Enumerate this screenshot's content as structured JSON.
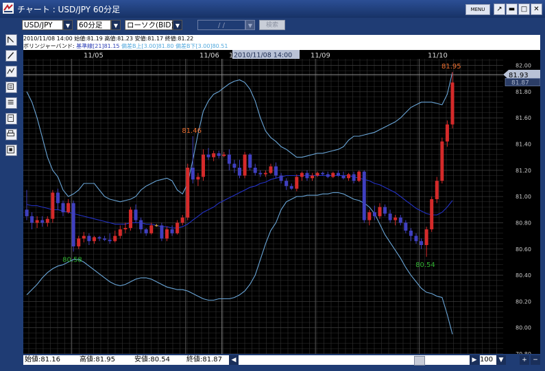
{
  "window": {
    "title": "チャート : USD/JPY 60分足",
    "menu_label": "MENU",
    "pin_glyph": "↗",
    "min_glyph": "▬",
    "max_glyph": "□",
    "close_glyph": "✕"
  },
  "toolbar": {
    "pair": "USD/JPY",
    "interval": "60分足",
    "price_type": "ローソク(BID)",
    "date_placeholder": "/ /",
    "search_label": "検索",
    "dropdown_glyph": "▼"
  },
  "info": {
    "line1": "2010/11/08 14:00  始値:81.19  高値:81.23  安値:81.17  終値:81.22",
    "bollinger_label": "ボリンジャーバンド:",
    "bollinger_base": "基準線[21]81.15",
    "bollinger_upper": "偏差B上[3.00]81.80",
    "bollinger_lower": "偏差B下[3.00]80.51"
  },
  "status": {
    "open": "始値:81.16",
    "high": "高値:81.95",
    "low": "安値:80.54",
    "close": "終値:81.87"
  },
  "zoom": {
    "value": "100",
    "plus": "+",
    "minus": "−"
  },
  "colors": {
    "bull": "#d42a2a",
    "bear": "#3f3fbf",
    "doji": "#e6b033",
    "band": "#6aa6d8",
    "base": "#2432c8",
    "grid": "#323232",
    "bg": "#000000",
    "high_label": "#f07030",
    "low_label": "#2fb02f"
  },
  "chart_data": {
    "type": "candlestick",
    "title": "USD/JPY 60分足",
    "x_labels": [
      "11/05",
      "11/06",
      "11/08",
      "11/09",
      "11/10"
    ],
    "ylim": [
      79.8,
      82.05
    ],
    "y_ticks": [
      79.8,
      80.0,
      80.2,
      80.4,
      80.6,
      80.8,
      81.0,
      81.2,
      81.4,
      81.6,
      81.8,
      82.0
    ],
    "crosshair": {
      "date_label": "2010/11/08 14:00",
      "price_label": "81.93"
    },
    "current_price": "81.87",
    "annotations": [
      {
        "text": "81.46",
        "kind": "high",
        "index": 32
      },
      {
        "text": "80.58",
        "kind": "low",
        "index": 9
      },
      {
        "text": "80.54",
        "kind": "low",
        "index": 77
      },
      {
        "text": "81.95",
        "kind": "high",
        "index": 82
      }
    ],
    "ohlc": [
      [
        80.9,
        81.05,
        80.82,
        80.85
      ],
      [
        80.85,
        80.88,
        80.75,
        80.8
      ],
      [
        80.8,
        80.85,
        80.76,
        80.82
      ],
      [
        80.82,
        80.85,
        80.77,
        80.8
      ],
      [
        80.8,
        80.85,
        80.77,
        80.83
      ],
      [
        80.83,
        81.05,
        80.8,
        81.03
      ],
      [
        81.03,
        81.06,
        80.9,
        80.95
      ],
      [
        80.95,
        80.97,
        80.85,
        80.88
      ],
      [
        80.88,
        80.98,
        80.87,
        80.95
      ],
      [
        80.95,
        80.97,
        80.58,
        80.62
      ],
      [
        80.62,
        80.7,
        80.6,
        80.68
      ],
      [
        80.68,
        80.73,
        80.65,
        80.7
      ],
      [
        80.7,
        80.72,
        80.63,
        80.66
      ],
      [
        80.66,
        80.7,
        80.64,
        80.69
      ],
      [
        80.69,
        80.7,
        80.66,
        80.68
      ],
      [
        80.68,
        80.7,
        80.66,
        80.67
      ],
      [
        80.67,
        80.72,
        80.64,
        80.66
      ],
      [
        80.66,
        80.74,
        80.65,
        80.7
      ],
      [
        80.7,
        80.78,
        80.68,
        80.75
      ],
      [
        80.75,
        80.8,
        80.72,
        80.76
      ],
      [
        80.76,
        80.92,
        80.74,
        80.9
      ],
      [
        80.9,
        80.94,
        80.8,
        80.82
      ],
      [
        80.82,
        80.84,
        80.72,
        80.75
      ],
      [
        80.75,
        80.76,
        80.7,
        80.72
      ],
      [
        80.72,
        80.8,
        80.71,
        80.78
      ],
      [
        80.78,
        80.79,
        80.77,
        80.78
      ],
      [
        80.78,
        80.8,
        80.66,
        80.68
      ],
      [
        80.68,
        80.77,
        80.66,
        80.75
      ],
      [
        80.75,
        80.78,
        80.7,
        80.72
      ],
      [
        80.72,
        80.82,
        80.71,
        80.8
      ],
      [
        80.8,
        80.86,
        80.78,
        80.84
      ],
      [
        80.84,
        81.25,
        80.82,
        81.22
      ],
      [
        81.22,
        81.46,
        81.1,
        81.13
      ],
      [
        81.13,
        81.18,
        81.08,
        81.15
      ],
      [
        81.15,
        81.36,
        81.12,
        81.32
      ],
      [
        81.32,
        81.37,
        81.28,
        81.3
      ],
      [
        81.3,
        81.35,
        81.27,
        81.33
      ],
      [
        81.33,
        81.35,
        81.29,
        81.31
      ],
      [
        81.31,
        81.34,
        81.3,
        81.32
      ],
      [
        81.32,
        81.36,
        81.2,
        81.25
      ],
      [
        81.25,
        81.28,
        81.18,
        81.22
      ],
      [
        81.22,
        81.28,
        81.14,
        81.16
      ],
      [
        81.16,
        81.34,
        81.14,
        81.32
      ],
      [
        81.32,
        81.33,
        81.2,
        81.22
      ],
      [
        81.22,
        81.25,
        81.16,
        81.18
      ],
      [
        81.18,
        81.2,
        81.15,
        81.17
      ],
      [
        81.17,
        81.2,
        81.15,
        81.18
      ],
      [
        81.18,
        81.25,
        81.17,
        81.23
      ],
      [
        81.23,
        81.26,
        81.14,
        81.16
      ],
      [
        81.16,
        81.18,
        81.1,
        81.12
      ],
      [
        81.12,
        81.14,
        81.05,
        81.08
      ],
      [
        81.08,
        81.1,
        81.05,
        81.06
      ],
      [
        81.06,
        81.17,
        81.04,
        81.15
      ],
      [
        81.15,
        81.19,
        81.12,
        81.18
      ],
      [
        81.18,
        81.2,
        81.12,
        81.14
      ],
      [
        81.14,
        81.18,
        81.12,
        81.16
      ],
      [
        81.16,
        81.19,
        81.15,
        81.18
      ],
      [
        81.18,
        81.19,
        81.16,
        81.17
      ],
      [
        81.17,
        81.19,
        81.14,
        81.15
      ],
      [
        81.15,
        81.19,
        81.14,
        81.18
      ],
      [
        81.18,
        81.2,
        81.15,
        81.16
      ],
      [
        81.16,
        81.19,
        81.13,
        81.14
      ],
      [
        81.14,
        81.18,
        81.12,
        81.17
      ],
      [
        81.17,
        81.19,
        81.1,
        81.12
      ],
      [
        81.12,
        81.2,
        81.11,
        81.19
      ],
      [
        81.19,
        81.2,
        80.8,
        80.82
      ],
      [
        80.82,
        80.9,
        80.78,
        80.88
      ],
      [
        80.88,
        80.93,
        80.82,
        80.85
      ],
      [
        80.85,
        80.95,
        80.83,
        80.92
      ],
      [
        80.92,
        80.94,
        80.85,
        80.87
      ],
      [
        80.87,
        80.9,
        80.8,
        80.82
      ],
      [
        80.82,
        80.86,
        80.78,
        80.84
      ],
      [
        80.84,
        80.86,
        80.78,
        80.8
      ],
      [
        80.8,
        80.82,
        80.72,
        80.74
      ],
      [
        80.74,
        80.76,
        80.66,
        80.7
      ],
      [
        80.7,
        80.72,
        80.64,
        80.66
      ],
      [
        80.66,
        80.68,
        80.6,
        80.63
      ],
      [
        80.63,
        80.77,
        80.54,
        80.75
      ],
      [
        80.75,
        81.0,
        80.73,
        80.98
      ],
      [
        80.98,
        81.15,
        80.95,
        81.12
      ],
      [
        81.12,
        81.45,
        81.1,
        81.42
      ],
      [
        81.42,
        81.58,
        81.38,
        81.55
      ],
      [
        81.55,
        81.95,
        81.52,
        81.87
      ]
    ],
    "bollinger_upper": [
      81.8,
      81.72,
      81.6,
      81.45,
      81.3,
      81.2,
      81.15,
      81.05,
      81.0,
      81.02,
      81.05,
      81.1,
      81.1,
      81.1,
      81.05,
      81.0,
      80.98,
      80.97,
      80.96,
      80.97,
      80.98,
      81.0,
      81.05,
      81.08,
      81.1,
      81.12,
      81.13,
      81.14,
      81.12,
      81.05,
      81.02,
      81.1,
      81.28,
      81.48,
      81.65,
      81.73,
      81.78,
      81.8,
      81.83,
      81.86,
      81.88,
      81.89,
      81.87,
      81.82,
      81.73,
      81.6,
      81.5,
      81.45,
      81.42,
      81.38,
      81.36,
      81.33,
      81.3,
      81.3,
      81.31,
      81.32,
      81.33,
      81.33,
      81.34,
      81.35,
      81.36,
      81.38,
      81.43,
      81.46,
      81.46,
      81.47,
      81.48,
      81.49,
      81.51,
      81.53,
      81.55,
      81.57,
      81.6,
      81.64,
      81.68,
      81.7,
      81.72,
      81.72,
      81.72,
      81.71,
      81.7,
      81.78,
      81.95
    ],
    "bollinger_base": [
      80.94,
      80.93,
      80.93,
      80.92,
      80.91,
      80.9,
      80.9,
      80.89,
      80.88,
      80.87,
      80.86,
      80.85,
      80.84,
      80.83,
      80.82,
      80.81,
      80.8,
      80.79,
      80.79,
      80.79,
      80.8,
      80.8,
      80.8,
      80.79,
      80.79,
      80.78,
      80.77,
      80.77,
      80.76,
      80.76,
      80.77,
      80.79,
      80.82,
      80.85,
      80.88,
      80.9,
      80.92,
      80.95,
      80.97,
      80.99,
      81.01,
      81.03,
      81.05,
      81.07,
      81.08,
      81.1,
      81.11,
      81.13,
      81.14,
      81.15,
      81.16,
      81.16,
      81.16,
      81.16,
      81.16,
      81.16,
      81.16,
      81.16,
      81.16,
      81.16,
      81.16,
      81.16,
      81.16,
      81.15,
      81.14,
      81.13,
      81.12,
      81.1,
      81.09,
      81.07,
      81.05,
      81.03,
      81.0,
      80.97,
      80.94,
      80.91,
      80.89,
      80.87,
      80.86,
      80.86,
      80.88,
      80.92,
      80.97
    ],
    "bollinger_lower": [
      80.25,
      80.29,
      80.33,
      80.38,
      80.42,
      80.45,
      80.47,
      80.48,
      80.5,
      80.52,
      80.52,
      80.5,
      80.47,
      80.44,
      80.41,
      80.38,
      80.35,
      80.33,
      80.32,
      80.33,
      80.35,
      80.37,
      80.38,
      80.38,
      80.37,
      80.35,
      80.33,
      80.31,
      80.3,
      80.29,
      80.29,
      80.28,
      80.26,
      80.24,
      80.22,
      80.21,
      80.21,
      80.22,
      80.22,
      80.22,
      80.23,
      80.25,
      80.28,
      80.33,
      80.4,
      80.52,
      80.64,
      80.74,
      80.8,
      80.9,
      80.96,
      80.98,
      81.0,
      81.0,
      81.01,
      81.01,
      81.01,
      81.02,
      81.02,
      81.03,
      81.03,
      81.02,
      81.0,
      80.98,
      80.97,
      80.95,
      80.92,
      80.87,
      80.79,
      80.71,
      80.65,
      80.59,
      80.53,
      80.46,
      80.4,
      80.35,
      80.3,
      80.27,
      80.26,
      80.24,
      80.23,
      80.1,
      79.95
    ]
  }
}
